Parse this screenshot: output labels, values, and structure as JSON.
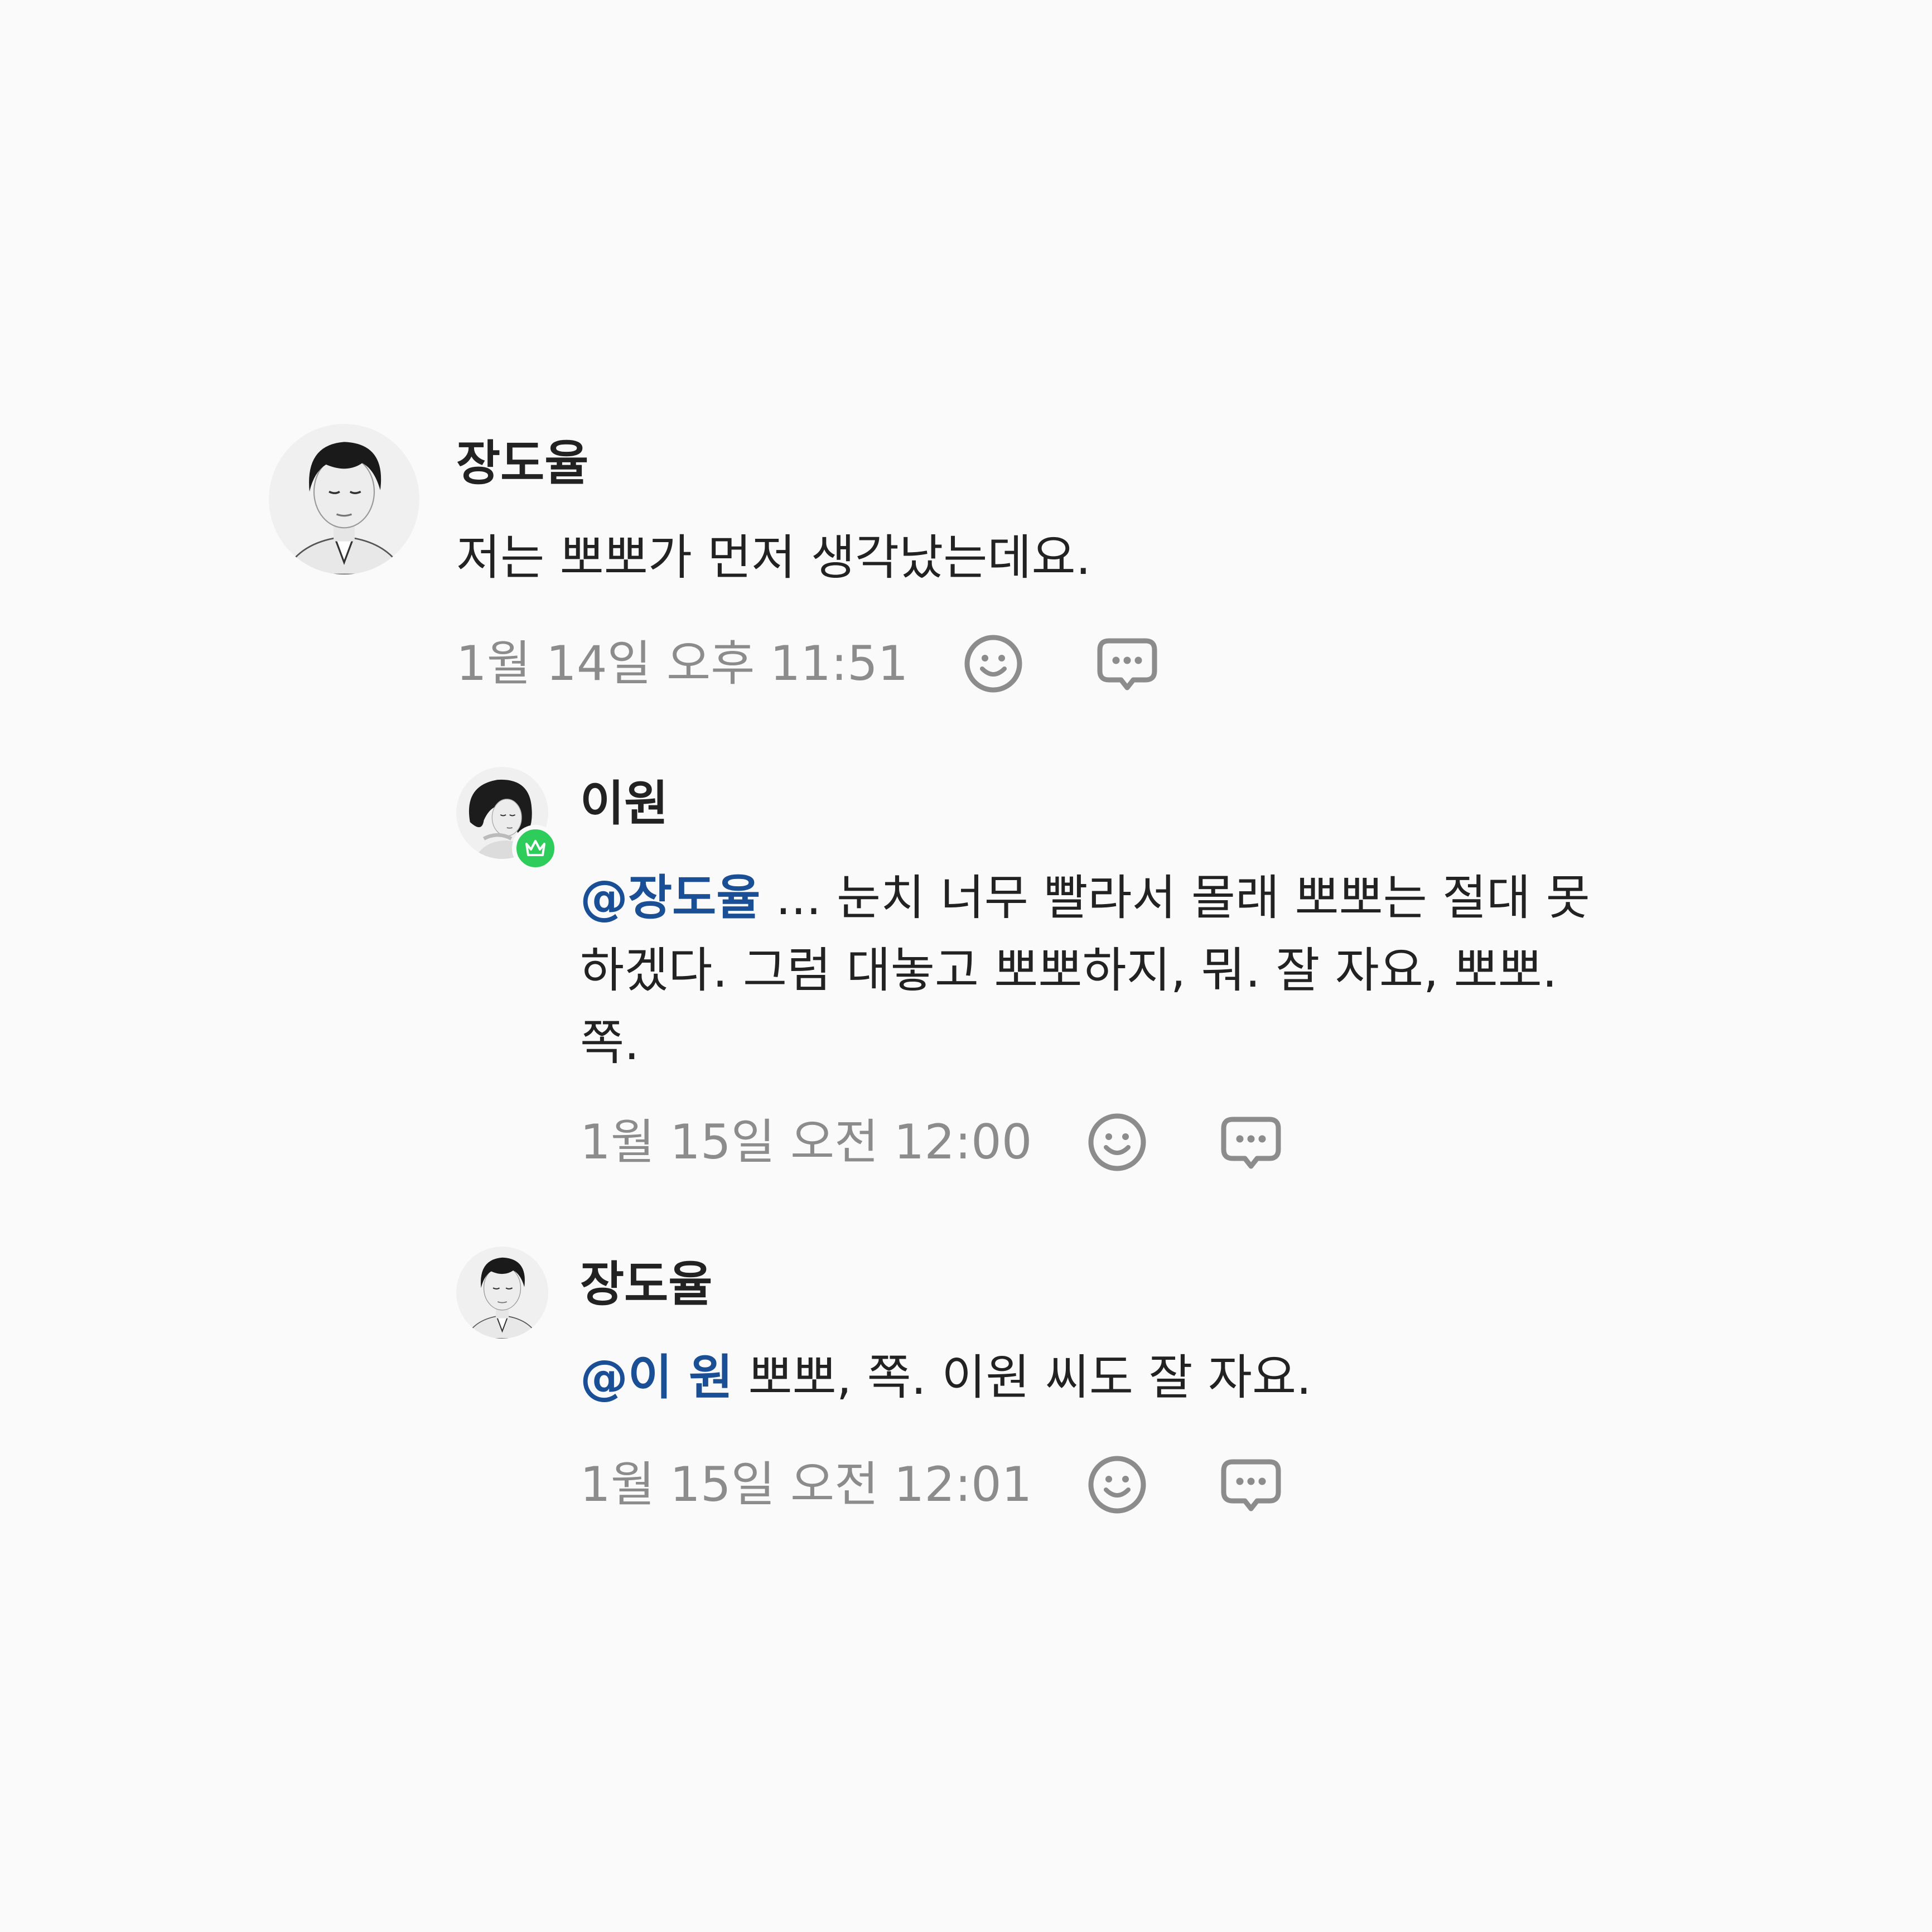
{
  "comments": [
    {
      "author": "장도율",
      "text": "저는 뽀뽀가 먼저 생각났는데요.",
      "timestamp": "1월 14일 오후 11:51",
      "avatar_icon": "male-avatar-photo",
      "actions": [
        "emoji-reaction-icon",
        "reply-icon"
      ]
    },
    {
      "author": "이원",
      "mention": "@장도율",
      "text_line1": " ... 눈치 너무 빨라서 몰래 뽀뽀는 절대 못",
      "text_line2": "하겠다. 그럼 대놓고 뽀뽀하지, 뭐. 잘 자요, 뽀뽀.",
      "text_line3": "쪽.",
      "timestamp": "1월 15일 오전 12:00",
      "avatar_icon": "female-avatar-photo",
      "badge_icon": "crown-icon",
      "badge_color": "#2ecc5b",
      "actions": [
        "emoji-reaction-icon",
        "reply-icon"
      ]
    },
    {
      "author": "장도율",
      "mention": "@이 원",
      "text": " 뽀뽀, 쪽. 이원 씨도 잘 자요.",
      "timestamp": "1월 15일 오전 12:01",
      "avatar_icon": "male-avatar-photo",
      "actions": [
        "emoji-reaction-icon",
        "reply-icon"
      ]
    }
  ],
  "colors": {
    "background": "#fafafa",
    "mention": "#1a4f96",
    "timestamp": "#8c8c8c",
    "icon": "#8c8c8c"
  }
}
